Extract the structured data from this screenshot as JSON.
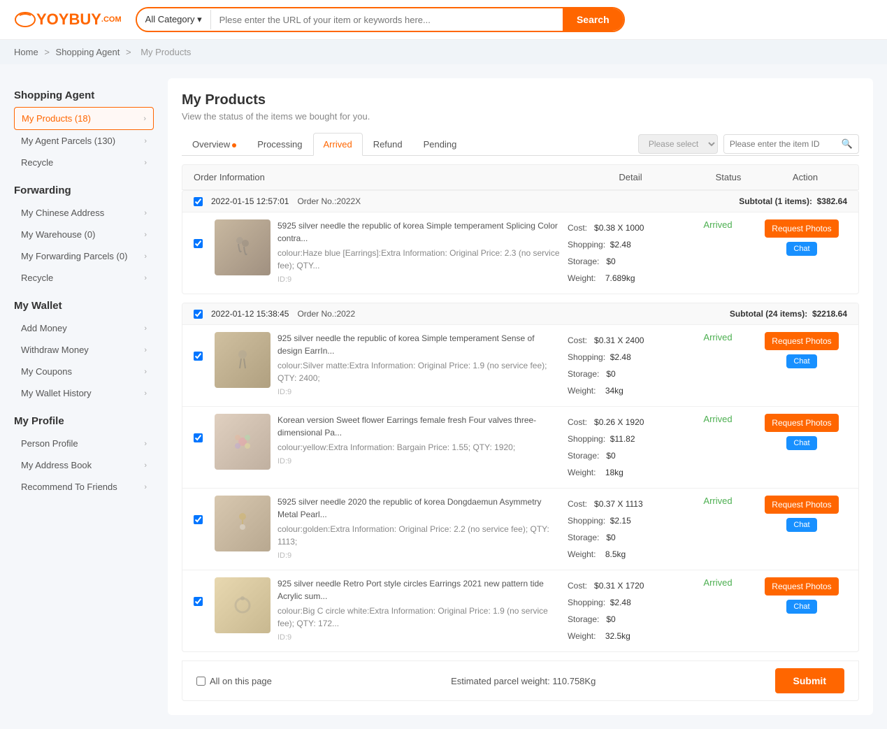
{
  "header": {
    "logo": "YOYBUY.COM",
    "logo_yoy": "YOY",
    "logo_buy": "BUY",
    "logo_com": ".COM",
    "search": {
      "category_label": "All Category ▾",
      "placeholder": "Plese enter the URL of your item or keywords here...",
      "button_label": "Search"
    }
  },
  "breadcrumb": {
    "items": [
      "Home",
      "Shopping Agent",
      "My Products"
    ]
  },
  "sidebar": {
    "shopping_agent_title": "Shopping Agent",
    "shopping_items": [
      {
        "label": "My Products (18)",
        "active": true
      },
      {
        "label": "My Agent Parcels (130)",
        "active": false
      },
      {
        "label": "Recycle",
        "active": false
      }
    ],
    "forwarding_title": "Forwarding",
    "forwarding_items": [
      {
        "label": "My Chinese Address",
        "active": false
      },
      {
        "label": "My Warehouse (0)",
        "active": false
      },
      {
        "label": "My Forwarding Parcels (0)",
        "active": false
      },
      {
        "label": "Recycle",
        "active": false
      }
    ],
    "wallet_title": "My Wallet",
    "wallet_items": [
      {
        "label": "Add Money",
        "active": false
      },
      {
        "label": "Withdraw Money",
        "active": false
      },
      {
        "label": "My Coupons",
        "active": false
      },
      {
        "label": "My Wallet History",
        "active": false
      }
    ],
    "profile_title": "My Profile",
    "profile_items": [
      {
        "label": "Person Profile",
        "active": false
      },
      {
        "label": "My Address Book",
        "active": false
      },
      {
        "label": "Recommend To Friends",
        "active": false
      }
    ]
  },
  "content": {
    "page_title": "My Products",
    "page_subtitle": "View the status of the items we bought for you.",
    "tabs": [
      {
        "label": "Overview",
        "active": false,
        "dot": true
      },
      {
        "label": "Processing",
        "active": false,
        "dot": false
      },
      {
        "label": "Arrived",
        "active": true,
        "dot": false
      },
      {
        "label": "Refund",
        "active": false,
        "dot": false
      },
      {
        "label": "Pending",
        "active": false,
        "dot": false
      }
    ],
    "filter_placeholder": "Please select",
    "search_placeholder": "Please enter the item ID",
    "table_headers": [
      "Order Information",
      "Detail",
      "Status",
      "Action"
    ],
    "orders": [
      {
        "id": "order1",
        "date": "2022-01-15 12:57:01",
        "order_no": "Order No.:2022X",
        "subtotal_label": "Subtotal (1 items):",
        "subtotal": "$382.64",
        "items": [
          {
            "checked": true,
            "thumb_class": "thumb-earring1",
            "title": "5925 silver needle the republic of korea Simple temperament Splicing Color contra...",
            "color": "colour:Haze blue [Earrings]:Extra Information: Original Price: 2.3 (no service fee); QTY...",
            "id": "ID:9",
            "cost_label": "Cost:",
            "cost": "$0.38 X 1000",
            "shipping_label": "Shopping:",
            "shipping": "$2.48",
            "storage_label": "Storage:",
            "storage": "$0",
            "weight_label": "Weight:",
            "weight": "7.689kg",
            "status": "Arrived",
            "btn_request": "Request Photos",
            "btn_chat": "Chat"
          }
        ]
      },
      {
        "id": "order2",
        "date": "2022-01-12 15:38:45",
        "order_no": "Order No.:2022",
        "subtotal_label": "Subtotal (24 items):",
        "subtotal": "$2218.64",
        "items": [
          {
            "checked": true,
            "thumb_class": "thumb-earring2",
            "title": "925 silver needle the republic of korea Simple temperament Sense of design EarrIn...",
            "color": "colour:Silver matte:Extra Information: Original Price: 1.9 (no service fee); QTY: 2400;",
            "id": "ID:9",
            "cost_label": "Cost:",
            "cost": "$0.31 X 2400",
            "shipping_label": "Shopping:",
            "shipping": "$2.48",
            "storage_label": "Storage:",
            "storage": "$0",
            "weight_label": "Weight:",
            "weight": "34kg",
            "status": "Arrived",
            "btn_request": "Request Photos",
            "btn_chat": "Chat"
          },
          {
            "checked": true,
            "thumb_class": "thumb-earring3",
            "title": "Korean version Sweet flower Earrings female fresh Four valves three-dimensional Pa...",
            "color": "colour:yellow:Extra Information: Bargain Price: 1.55; QTY: 1920;",
            "id": "ID:9",
            "cost_label": "Cost:",
            "cost": "$0.26 X 1920",
            "shipping_label": "Shopping:",
            "shipping": "$11.82",
            "storage_label": "Storage:",
            "storage": "$0",
            "weight_label": "Weight:",
            "weight": "18kg",
            "status": "Arrived",
            "btn_request": "Request Photos",
            "btn_chat": "Chat"
          },
          {
            "checked": true,
            "thumb_class": "thumb-earring4",
            "title": "5925 silver needle 2020 the republic of korea Dongdaemun Asymmetry Metal Pearl...",
            "color": "colour:golden:Extra Information: Original Price: 2.2 (no service fee); QTY: 1113;",
            "id": "ID:9",
            "cost_label": "Cost:",
            "cost": "$0.37 X 1113",
            "shipping_label": "Shopping:",
            "shipping": "$2.15",
            "storage_label": "Storage:",
            "storage": "$0",
            "weight_label": "Weight:",
            "weight": "8.5kg",
            "status": "Arrived",
            "btn_request": "Request Photos",
            "btn_chat": "Chat"
          },
          {
            "checked": true,
            "thumb_class": "thumb-earring5",
            "title": "925 silver needle Retro Port style circles Earrings 2021 new pattern tide Acrylic sum...",
            "color": "colour:Big C circle white:Extra Information: Original Price: 1.9 (no service fee); QTY: 172...",
            "id": "ID:9",
            "cost_label": "Cost:",
            "cost": "$0.31 X 1720",
            "shipping_label": "Shopping:",
            "shipping": "$2.48",
            "storage_label": "Storage:",
            "storage": "$0",
            "weight_label": "Weight:",
            "weight": "32.5kg",
            "status": "Arrived",
            "btn_request": "Request Photos",
            "btn_chat": "Chat"
          }
        ]
      }
    ],
    "footer": {
      "all_on_page": "All on this page",
      "weight_info": "Estimated parcel weight: 110.758Kg",
      "submit_label": "Submit"
    }
  },
  "colors": {
    "accent": "#f60",
    "arrived": "#4caf50",
    "border_active": "#f60"
  }
}
